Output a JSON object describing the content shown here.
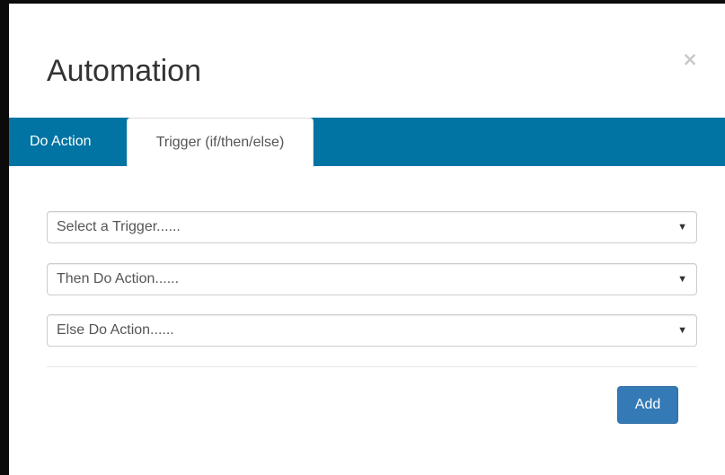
{
  "modal": {
    "title": "Automation",
    "close_label": "×"
  },
  "tabs": [
    {
      "label": "Do Action",
      "active": false
    },
    {
      "label": "Trigger (if/then/else)",
      "active": true
    }
  ],
  "form": {
    "trigger_select": {
      "selected": "Select a Trigger......"
    },
    "then_select": {
      "selected": "Then Do Action......"
    },
    "else_select": {
      "selected": "Else Do Action......"
    },
    "caret": "▼"
  },
  "footer": {
    "add_label": "Add"
  },
  "colors": {
    "tab_bar": "#0274a3",
    "primary_button": "#337ab7",
    "backdrop": "#0b0b0b"
  }
}
